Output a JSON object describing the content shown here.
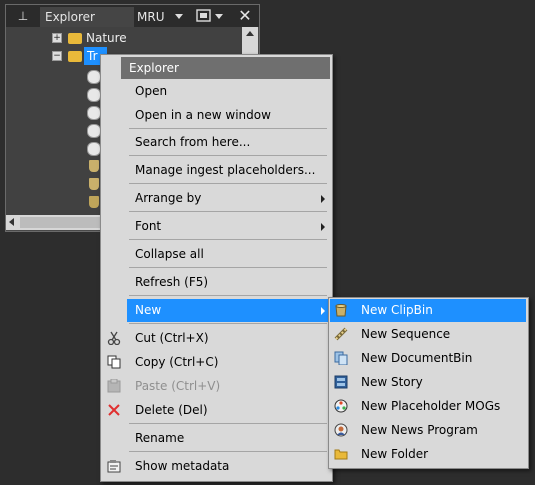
{
  "panel": {
    "tab_label": "Explorer",
    "mru_label": "MRU",
    "close_glyph": "✕",
    "pin_glyph": "⊥",
    "tree": [
      {
        "label": "Nature",
        "expander": "+",
        "icon": "folder-icon"
      },
      {
        "label": "Tr",
        "expander": "−",
        "icon": "folder-open-icon"
      }
    ]
  },
  "context_menu": {
    "header": "Explorer",
    "items": [
      {
        "label": "Open"
      },
      {
        "label": "Open in a new window"
      },
      {
        "label": "Search from here..."
      },
      {
        "label": "Manage ingest placeholders..."
      },
      {
        "label": "Arrange by"
      },
      {
        "label": "Font"
      },
      {
        "label": "Collapse all"
      },
      {
        "label": "Refresh (F5)"
      },
      {
        "label": "New"
      },
      {
        "label": "Cut (Ctrl+X)"
      },
      {
        "label": "Copy (Ctrl+C)"
      },
      {
        "label": "Paste (Ctrl+V)"
      },
      {
        "label": "Delete (Del)"
      },
      {
        "label": "Rename"
      },
      {
        "label": "Show metadata"
      }
    ]
  },
  "submenu": {
    "items": [
      {
        "label": "New ClipBin",
        "icon": "clipbin-icon"
      },
      {
        "label": "New Sequence",
        "icon": "sequence-icon"
      },
      {
        "label": "New DocumentBin",
        "icon": "documentbin-icon"
      },
      {
        "label": "New Story",
        "icon": "story-icon"
      },
      {
        "label": "New Placeholder MOGs",
        "icon": "placeholder-mogs-icon"
      },
      {
        "label": "New News Program",
        "icon": "news-program-icon"
      },
      {
        "label": "New Folder",
        "icon": "folder-icon"
      }
    ]
  },
  "colors": {
    "selection": "#1e90ff",
    "menu_bg": "#d9d9d9",
    "header_bg": "#6f6f6f",
    "desktop": "#2d2d2d"
  }
}
